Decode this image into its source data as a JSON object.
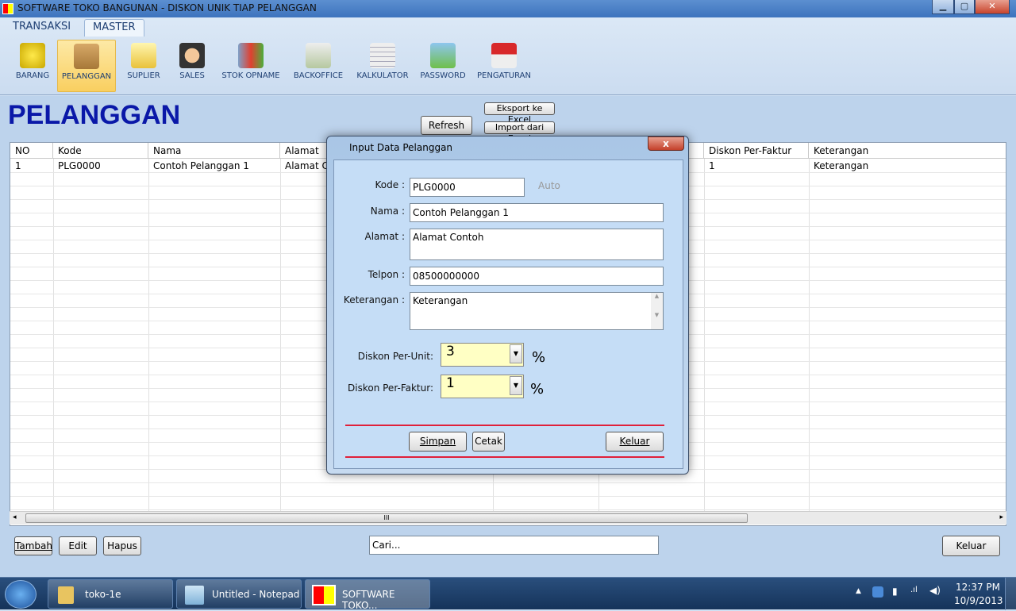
{
  "window": {
    "title": "SOFTWARE TOKO BANGUNAN - DISKON UNIK TIAP PELANGGAN",
    "min": "▁",
    "max": "▢",
    "close": "✕"
  },
  "ribbon": {
    "tabs": [
      {
        "label": "TRANSAKSI"
      },
      {
        "label": "MASTER"
      }
    ],
    "tools": [
      {
        "label": "BARANG",
        "icon": "coins-icon"
      },
      {
        "label": "PELANGGAN",
        "icon": "package-icon"
      },
      {
        "label": "SUPLIER",
        "icon": "folder-icon"
      },
      {
        "label": "SALES",
        "icon": "person-icon"
      },
      {
        "label": "STOK OPNAME",
        "icon": "chart-check-icon"
      },
      {
        "label": "BACKOFFICE",
        "icon": "money-icon"
      },
      {
        "label": "KALKULATOR",
        "icon": "calculator-icon"
      },
      {
        "label": "PASSWORD",
        "icon": "lock-icon"
      },
      {
        "label": "PENGATURAN",
        "icon": "house-icon"
      }
    ]
  },
  "page": {
    "title": "PELANGGAN",
    "refresh": "Refresh",
    "export": "Eksport ke Excel",
    "import": "Import dari Excel"
  },
  "table": {
    "columns": [
      "NO",
      "Kode",
      "Nama",
      "Alamat",
      "",
      "",
      "Diskon Per-Faktur",
      "Keterangan"
    ],
    "rows": [
      [
        "1",
        "PLG0000",
        "Contoh Pelanggan 1",
        "Alamat C",
        "",
        "",
        "1",
        "Keterangan"
      ]
    ]
  },
  "footer": {
    "tambah": "Tambah",
    "edit": "Edit",
    "hapus": "Hapus",
    "search_value": "Cari...",
    "keluar": "Keluar"
  },
  "dialog": {
    "title": "Input Data Pelanggan",
    "close": "x",
    "kode_label": "Kode :",
    "kode": "PLG0000",
    "auto": "Auto",
    "nama_label": "Nama :",
    "nama": "Contoh Pelanggan 1",
    "alamat_label": "Alamat :",
    "alamat": "Alamat Contoh",
    "telpon_label": "Telpon :",
    "telpon": "08500000000",
    "keterangan_label": "Keterangan :",
    "keterangan": "Keterangan",
    "diskon_unit_label": "Diskon Per-Unit:",
    "diskon_unit": "3",
    "diskon_faktur_label": "Diskon Per-Faktur:",
    "diskon_faktur": "1",
    "percent": "%",
    "simpan": "Simpan",
    "cetak": "Cetak",
    "keluar": "Keluar"
  },
  "taskbar": {
    "items": [
      {
        "label": "toko-1e"
      },
      {
        "label": "Untitled - Notepad"
      },
      {
        "label": "SOFTWARE TOKO..."
      }
    ],
    "time": "12:37 PM",
    "date": "10/9/2013"
  },
  "colors": {
    "heading": "#0a18a8",
    "accent_line": "#e0203a",
    "combo_bg": "#ffffc4"
  }
}
